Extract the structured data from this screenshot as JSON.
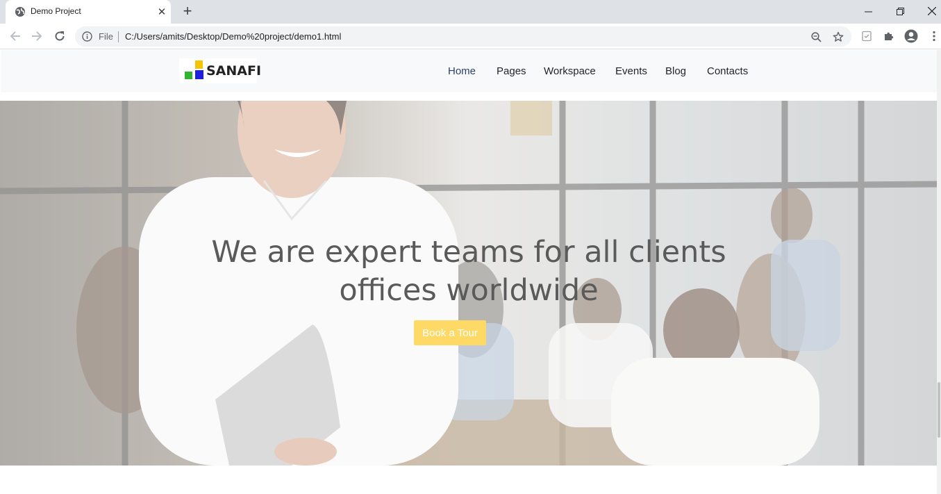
{
  "browser": {
    "tab": {
      "title": "Demo Project"
    },
    "omnibox": {
      "scheme_label": "File",
      "url": "C:/Users/amits/Desktop/Demo%20project/demo1.html"
    }
  },
  "site": {
    "logo_text": "SANAFI",
    "nav": [
      {
        "label": "Home",
        "active": true
      },
      {
        "label": "Pages"
      },
      {
        "label": "Workspace"
      },
      {
        "label": "Events"
      },
      {
        "label": "Blog"
      },
      {
        "label": "Contacts"
      }
    ],
    "hero": {
      "title_line1": "We are expert teams for all clients",
      "title_line2": "offices worldwide",
      "cta_label": "Book a Tour"
    }
  },
  "colors": {
    "accent_button": "#ffd965",
    "nav_active": "#2b3f6c",
    "logo_yellow": "#f5c400",
    "logo_green": "#2fb52f",
    "logo_blue": "#1f1fe0"
  },
  "icons": {
    "tab_favicon": "globe-icon",
    "tab_close": "close-icon",
    "new_tab": "plus-icon",
    "back": "arrow-left-icon",
    "forward": "arrow-right-icon",
    "reload": "reload-icon",
    "info": "info-icon",
    "zoom": "zoom-out-icon",
    "bookmark": "star-icon",
    "extension": "puzzle-icon",
    "profile": "account-icon",
    "menu": "more-vertical-icon"
  }
}
